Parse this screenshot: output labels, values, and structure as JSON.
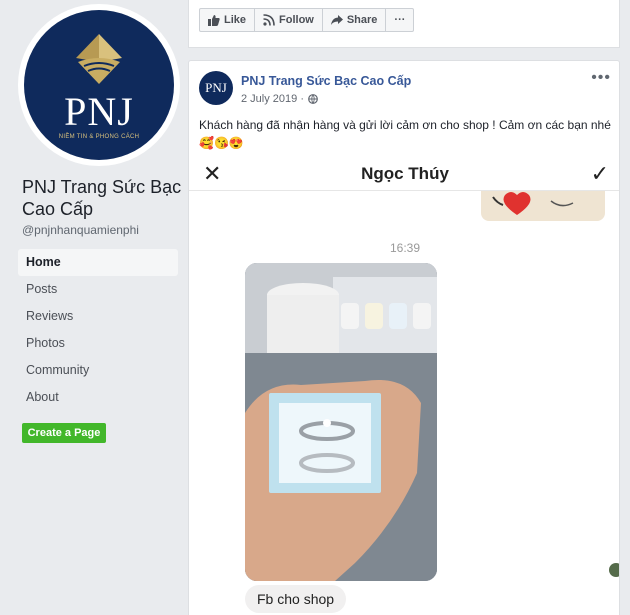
{
  "page": {
    "logo_text": "PNJ",
    "logo_tagline": "NIỀM TIN & PHONG CÁCH",
    "name": "PNJ Trang Sức Bạc Cao Cấp",
    "handle": "@pnjnhanquamienphi"
  },
  "nav": {
    "items": [
      {
        "label": "Home"
      },
      {
        "label": "Posts"
      },
      {
        "label": "Reviews"
      },
      {
        "label": "Photos"
      },
      {
        "label": "Community"
      },
      {
        "label": "About"
      }
    ],
    "create_button": "Create a Page"
  },
  "actions": {
    "like": "Like",
    "follow": "Follow",
    "share": "Share",
    "more": "···"
  },
  "post": {
    "avatar_text": "PNJ",
    "author": "PNJ Trang Sức Bạc Cao Cấp",
    "date": "2 July 2019 ·",
    "more": "•••",
    "text": "Khách hàng đã nhận hàng và gửi lời cảm ơn cho shop ! Cảm ơn các bạn nhé 🥰😘😍"
  },
  "screenshot": {
    "close_glyph": "✕",
    "contact_name": "Ngọc Thúy",
    "check_glyph": "✓",
    "time": "16:39",
    "message": "Fb cho shop"
  },
  "colors": {
    "brand_navy": "#0f2a5c",
    "link_blue": "#385898",
    "create_green": "#42b72a"
  }
}
